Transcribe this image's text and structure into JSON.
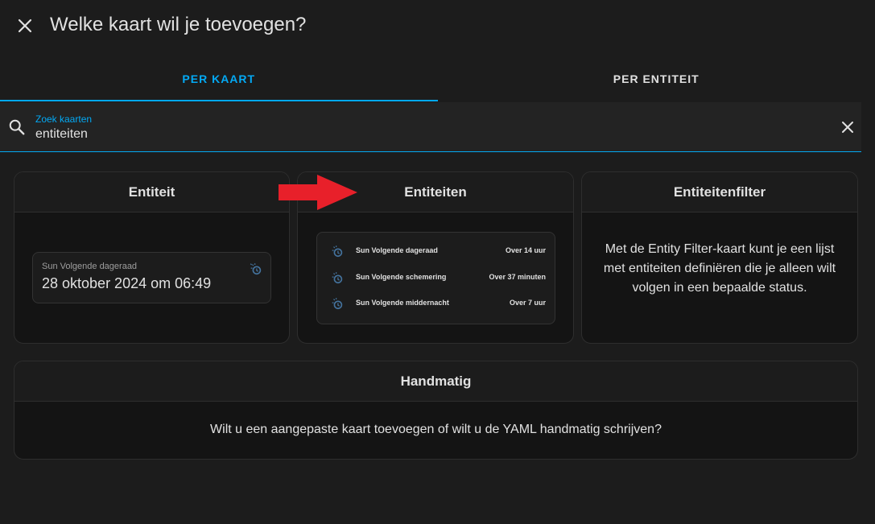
{
  "dialog": {
    "title": "Welke kaart wil je toevoegen?"
  },
  "tabs": [
    {
      "label": "PER KAART",
      "active": true
    },
    {
      "label": "PER ENTITEIT",
      "active": false
    }
  ],
  "search": {
    "label": "Zoek kaarten",
    "value": "entiteiten"
  },
  "cards": {
    "entity": {
      "title": "Entiteit",
      "preview": {
        "name": "Sun Volgende dageraad",
        "value": "28 oktober 2024 om 06:49",
        "icon": "weather-sunset-icon"
      }
    },
    "entities": {
      "title": "Entiteiten",
      "rows": [
        {
          "name": "Sun Volgende dageraad",
          "value": "Over 14 uur",
          "icon": "weather-sunset-icon"
        },
        {
          "name": "Sun Volgende schemering",
          "value": "Over 37 minuten",
          "icon": "weather-sunset-icon"
        },
        {
          "name": "Sun Volgende middernacht",
          "value": "Over 7 uur",
          "icon": "weather-sunset-icon"
        }
      ]
    },
    "entity_filter": {
      "title": "Entiteitenfilter",
      "description": "Met de Entity Filter-kaart kunt je een lijst met entiteiten definiëren die je alleen wilt volgen in een bepaalde status."
    },
    "manual": {
      "title": "Handmatig",
      "description": "Wilt u een aangepaste kaart toevoegen of wilt u de YAML handmatig schrijven?"
    }
  },
  "colors": {
    "accent": "#03a9f4",
    "background": "#1c1c1c",
    "annotation_arrow": "#e8202a"
  }
}
